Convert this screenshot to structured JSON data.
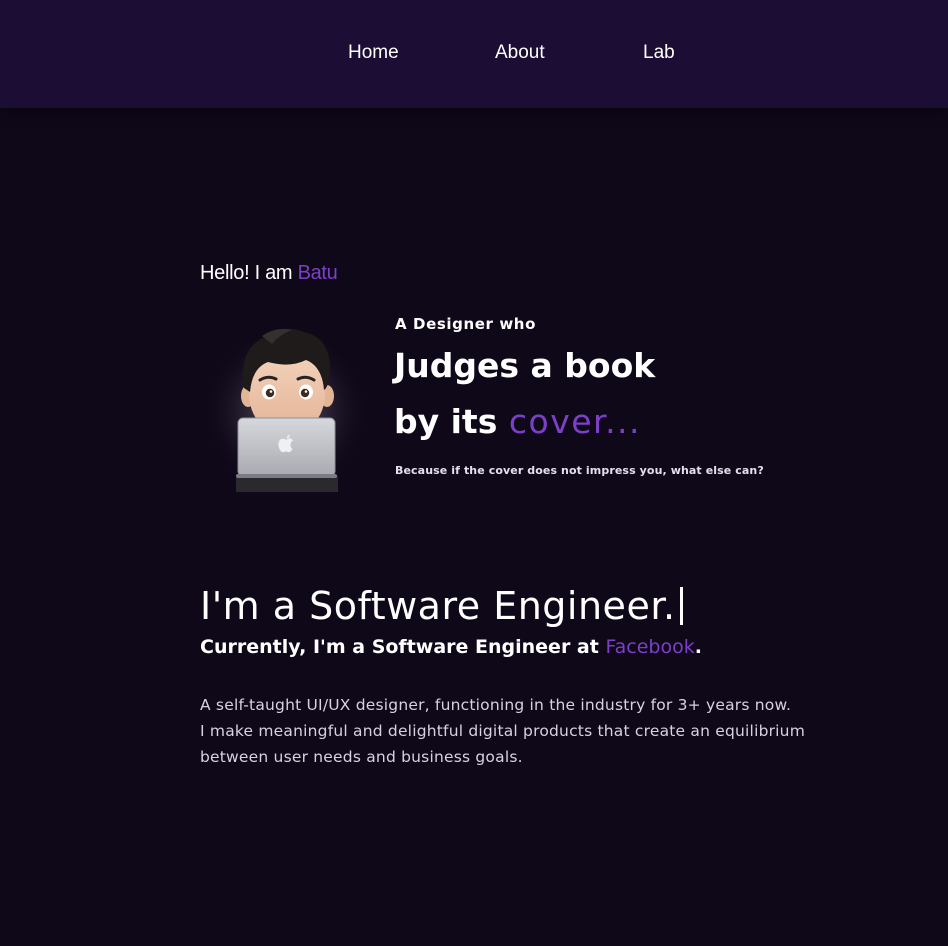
{
  "nav": {
    "items": [
      {
        "label": "Home"
      },
      {
        "label": "About"
      },
      {
        "label": "Lab"
      }
    ]
  },
  "hero": {
    "greeting": "Hello! I am",
    "name": "Batu",
    "tagline_small": "A Designer who",
    "tagline_line1": "Judges a book",
    "tagline_line2_prefix": "by its",
    "tagline_line2_accent": "cover...",
    "subline": "Because if the cover does not impress you, what else can?"
  },
  "intro": {
    "role": "I'm a Software Engineer.",
    "current_prefix": "Currently, I'm a Software Engineer at",
    "company": "Facebook",
    "current_suffix": ".",
    "bio_lines": [
      "A self-taught UI/UX designer, functioning in the industry for 3+ years now.",
      "I make meaningful and delightful digital products that create an equilibrium",
      "between user needs and business goals."
    ]
  },
  "colors": {
    "background": "#0f0819",
    "navbar": "#1b0d33",
    "accent": "#7d3fc8"
  },
  "icons": {
    "avatar": "memoji-avatar-with-laptop-icon",
    "laptop_logo": "apple-logo-icon"
  }
}
